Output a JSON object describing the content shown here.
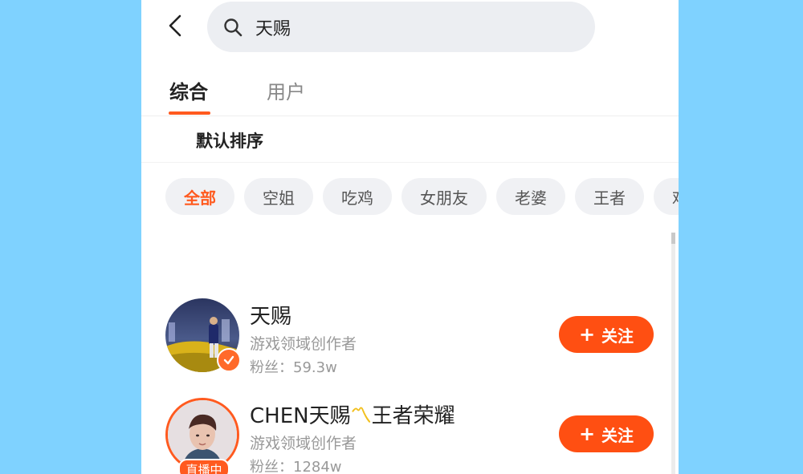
{
  "search": {
    "query": "天赐"
  },
  "tabs": [
    {
      "label": "综合",
      "active": true
    },
    {
      "label": "用户",
      "active": false
    }
  ],
  "sort": {
    "label": "默认排序"
  },
  "chips": [
    {
      "label": "全部",
      "active": true
    },
    {
      "label": "空姐"
    },
    {
      "label": "吃鸡"
    },
    {
      "label": "女朋友"
    },
    {
      "label": "老婆"
    },
    {
      "label": "王者"
    },
    {
      "label": "鸡"
    }
  ],
  "users": [
    {
      "name": "天赐",
      "desc": "游戏领域创作者",
      "fans": "粉丝：59.3w",
      "follow_label": "关注",
      "verified": true
    },
    {
      "name_prefix": "CHEN天赐",
      "name_mark": "〽",
      "name_suffix": "王者荣耀",
      "desc": "游戏领域创作者",
      "fans": "粉丝：1284w",
      "follow_label": "关注",
      "live_label": "直播中"
    }
  ],
  "colors": {
    "accent": "#ff5a1f",
    "background": "#7fd2ff"
  }
}
